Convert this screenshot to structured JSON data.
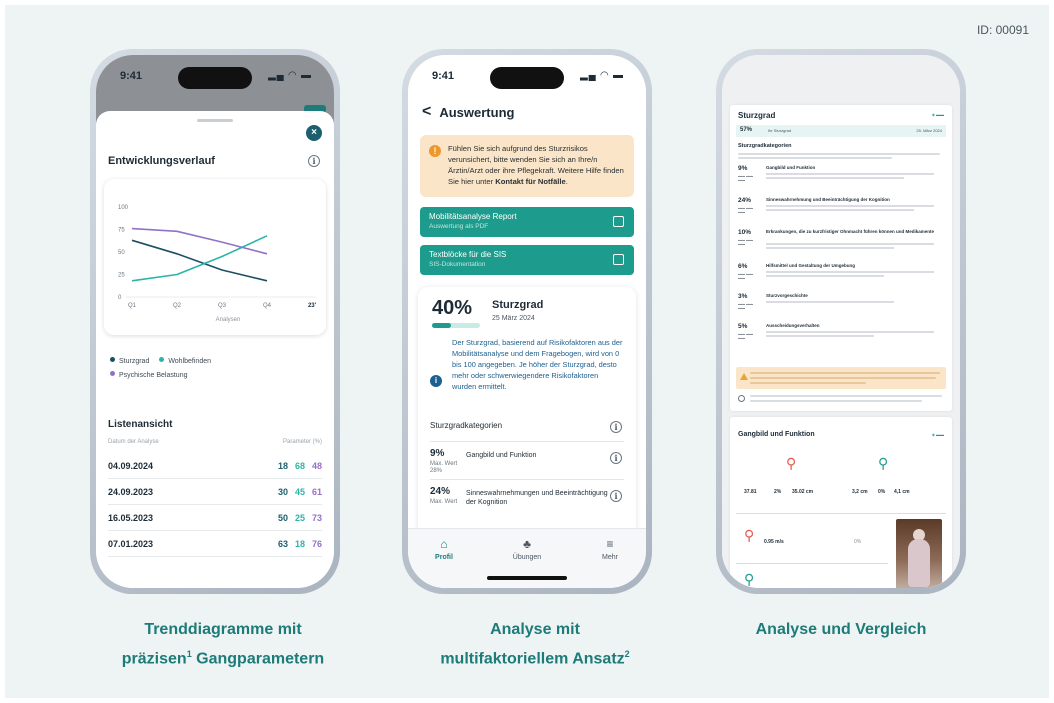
{
  "page_id": "ID: 00091",
  "captions": {
    "left": {
      "line1": "Trenddiagramme mit",
      "line2_pre": "präzisen",
      "line2_sup": "1",
      "line2_post": " Gangparametern"
    },
    "middle": {
      "line1": "Analyse mit",
      "line2": "multifaktoriellem Ansatz",
      "line2_sup": "2"
    },
    "right": {
      "line1": "Analyse und Vergleich"
    }
  },
  "phone1": {
    "time": "9:41",
    "close_glyph": "×",
    "title": "Entwicklungsverlauf",
    "chart_data": {
      "type": "line",
      "categories": [
        "Q1",
        "Q2",
        "Q3",
        "Q4",
        "23'"
      ],
      "ylim": [
        0,
        100
      ],
      "yticks": [
        0,
        25,
        50,
        75,
        100
      ],
      "xlabel": "Analysen",
      "series": [
        {
          "name": "Sturzgrad",
          "color": "#1d4f63",
          "values": [
            63,
            48,
            30,
            18
          ]
        },
        {
          "name": "Wohlbefinden",
          "color": "#2bb5a6",
          "values": [
            18,
            25,
            45,
            68
          ]
        },
        {
          "name": "Psychische Belastung",
          "color": "#9370c8",
          "values": [
            76,
            73,
            61,
            48
          ]
        }
      ]
    },
    "legend": [
      "Sturzgrad",
      "Wohlbefinden",
      "Psychische Belastung"
    ],
    "list": {
      "title": "Listenansicht",
      "col_date": "Datum der Analyse",
      "col_params": "Parameter (%)",
      "rows": [
        {
          "date": "04.09.2024",
          "v1": "18",
          "v2": "68",
          "v3": "48"
        },
        {
          "date": "24.09.2023",
          "v1": "30",
          "v2": "45",
          "v3": "61"
        },
        {
          "date": "16.05.2023",
          "v1": "50",
          "v2": "25",
          "v3": "73"
        },
        {
          "date": "07.01.2023",
          "v1": "63",
          "v2": "18",
          "v3": "76"
        }
      ]
    },
    "colors": {
      "v1": "#1d5f6e",
      "v2": "#2bb5a6",
      "v3": "#9370c8"
    }
  },
  "phone2": {
    "time": "9:41",
    "back_glyph": "<",
    "title": "Auswertung",
    "warning_text": "Fühlen Sie sich aufgrund des Sturzrisikos verunsichert, bitte wenden Sie sich an Ihre/n Ärztin/Arzt oder ihre Pflegekraft. Weitere Hilfe finden Sie hier unter ",
    "warning_link": "Kontakt für Notfälle",
    "warning_end": ".",
    "btn_report_title": "Mobilitätsanalyse Report",
    "btn_report_sub": "Auswertung als PDF",
    "btn_sis_title": "Textblöcke für die SIS",
    "btn_sis_sub": "SIS-Dokumentation",
    "score_pct": "40%",
    "score_value": 40,
    "score_name": "Sturzgrad",
    "score_date": "25 März 2024",
    "score_desc": "Der Sturzgrad, basierend auf Risikofaktoren aus der Mobilitätsanalyse und dem Fragebogen, wird von 0 bis 100 angegeben. Je höher der Sturzgrad, desto mehr oder schwerwiegendere Risikofaktoren wurden ermittelt.",
    "categories_title": "Sturzgradkategorien",
    "categories": [
      {
        "value": "9%",
        "max_label": "Max. Wert",
        "max_value": "28%",
        "name": "Gangbild und Funktion"
      },
      {
        "value": "24%",
        "max_label": "Max. Wert",
        "max_value": "",
        "name": "Sinneswahrnehmungen und Beeinträchtigung der Kognition"
      }
    ],
    "nav": [
      {
        "label": "Profil",
        "icon": "⌂"
      },
      {
        "label": "Übungen",
        "icon": "♣"
      },
      {
        "label": "Mehr",
        "icon": "≡"
      }
    ]
  },
  "phone3": {
    "doc_title": "Sturzgrad",
    "summary_pct": "57%",
    "summary_label": "Ihr Sturzgrad",
    "summary_date": "25. März 2024",
    "section_title": "Sturzgradkategorien",
    "rows": [
      {
        "value": "9%",
        "name": "Gangbild und Funktion"
      },
      {
        "value": "24%",
        "name": "Sinneswahrnehmung und Beeinträchtigung der Kognition"
      },
      {
        "value": "10%",
        "name": "Erkrankungen, die zu kurzfristiger Ohnmacht führen können und Medikamente"
      },
      {
        "value": "6%",
        "name": "Hilfsmittel und Gestaltung der Umgebung"
      },
      {
        "value": "3%",
        "name": "Sturzvorgeschichte"
      },
      {
        "value": "5%",
        "name": "Ausscheidungsverhalten"
      }
    ],
    "gait_title": "Gangbild und Funktion",
    "metrics": [
      {
        "value": "37.81",
        "unit": ""
      },
      {
        "value": "2%",
        "unit": ""
      },
      {
        "value": "35.02 cm",
        "unit": ""
      },
      {
        "value": "3,2 cm",
        "unit": ""
      },
      {
        "value": "0%",
        "unit": ""
      },
      {
        "value": "4,1 cm",
        "unit": ""
      }
    ],
    "speed_value": "0.95 m/s",
    "speed_pct": "0%"
  }
}
